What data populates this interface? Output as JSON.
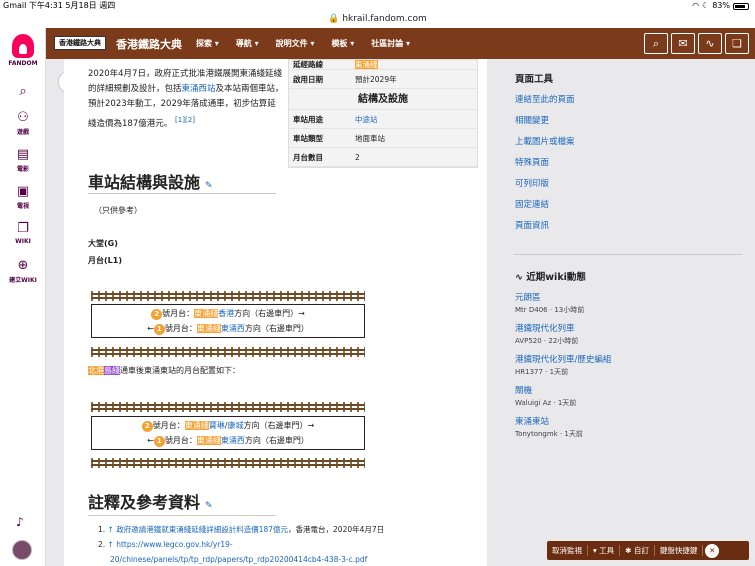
{
  "statusbar": {
    "left": "Gmail  下午4:31  5月18日 週四",
    "battery": "83%"
  },
  "url": "hkrail.fandom.com",
  "rail": {
    "brand": "FANDOM",
    "items": [
      {
        "label": "遊戲",
        "icon": "game-icon"
      },
      {
        "label": "電影",
        "icon": "movie-icon"
      },
      {
        "label": "電視",
        "icon": "tv-icon"
      },
      {
        "label": "WIKI",
        "icon": "wiki-icon"
      },
      {
        "label": "建立WIKI",
        "icon": "plus-icon"
      }
    ]
  },
  "wikinav": {
    "logo_text": "香港鐵路大典",
    "name": "香港鐵路大典",
    "menu": [
      "探索 ▾",
      "導航 ▾",
      "說明文件 ▾",
      "模板 ▾",
      "社區討論 ▾"
    ]
  },
  "article": {
    "intro_a": "2020年4月7日，政府正式批准港鐵展開東涌綫延綫的詳細規劃及設計，包括",
    "intro_link": "東涌西站",
    "intro_b": "及本站兩個車站，預計2023年動工，2029年落成通車，初步估算延綫造價為187億港元。",
    "intro_ref": "[1][2]",
    "infobox": {
      "rows_top": [
        {
          "k": "延經路線",
          "v": "東涌綫"
        },
        {
          "k": "啟用日期",
          "v": "預計2029年"
        }
      ],
      "head": "結構及設施",
      "rows": [
        {
          "k": "車站用途",
          "v": "中途站"
        },
        {
          "k": "車站類型",
          "v": "地面車站"
        },
        {
          "k": "月台數目",
          "v": "2"
        }
      ]
    },
    "section1": "車站結構與設施",
    "only_ref": "（只供參考）",
    "level_g": "大堂(G)",
    "level_l1": "月台(L1)",
    "diagram1": {
      "p2": {
        "num": "2",
        "pre": "號月台：",
        "line": "東涌綫",
        "dest": "香港",
        "post": "方向（右邊車門）→"
      },
      "p1": {
        "arrow": "←",
        "num": "1",
        "pre": "號月台：",
        "line": "東涌綫",
        "dest": "東涌西",
        "post": "方向（右邊車門）"
      }
    },
    "note_a": "北港",
    "note_b": "島綫",
    "note_c": "通車後東涌東站的月台配置如下：",
    "diagram2": {
      "p2": {
        "num": "2",
        "pre": "號月台：",
        "line": "東涌綫",
        "dest": "寶琳",
        "sep": "/",
        "dest2": "康城",
        "post": "方向（右邊車門）→"
      },
      "p1": {
        "arrow": "←",
        "num": "1",
        "pre": "號月台：",
        "line": "東涌綫",
        "dest": "東涌西",
        "post": "方向（右邊車門）"
      }
    },
    "section2": "註釋及參考資料",
    "ref1_link": "↑ 政府邀請港鐵就東涌綫延綫詳細設計料造價187億元",
    "ref1_rest": "，香港電台，2020年4月7日",
    "ref2_num": "2.",
    "ref1_num": "1.",
    "ref2_link": "↑ https://www.legco.gov.hk/yr19-",
    "ref2_link2": "20/chinese/panels/tp/tp_rdp/papers/tp_rdp20200414cb4-438-3-c.pdf"
  },
  "sidebar": {
    "tools_title": "頁面工具",
    "tools": [
      "連結至此的頁面",
      "相關變更",
      "上載圖片或檔案",
      "特殊頁面",
      "可列印版",
      "固定連結",
      "頁面資訊"
    ],
    "recent_title": "近期wiki動態",
    "recent": [
      {
        "title": "元朗區",
        "meta": "Mtr D406 · 13小時前"
      },
      {
        "title": "港鐵現代化列車",
        "meta": "AVP520 · 22小時前"
      },
      {
        "title": "港鐵現代化列車/歷史編組",
        "meta": "HR1377 · 1天前"
      },
      {
        "title": "閘機",
        "meta": "Waluigi Az · 1天前"
      },
      {
        "title": "東涌東站",
        "meta": "Tonytongmk · 1天前"
      }
    ]
  },
  "bottombar": [
    "取消監視",
    "▾ 工具",
    "✱ 自訂",
    "鍵盤快捷鍵"
  ],
  "colors": {
    "brand": "#7b3a1a",
    "accent_orange": "#f5a030",
    "accent_purple": "#9c4fd1",
    "link": "#1a66bb"
  }
}
